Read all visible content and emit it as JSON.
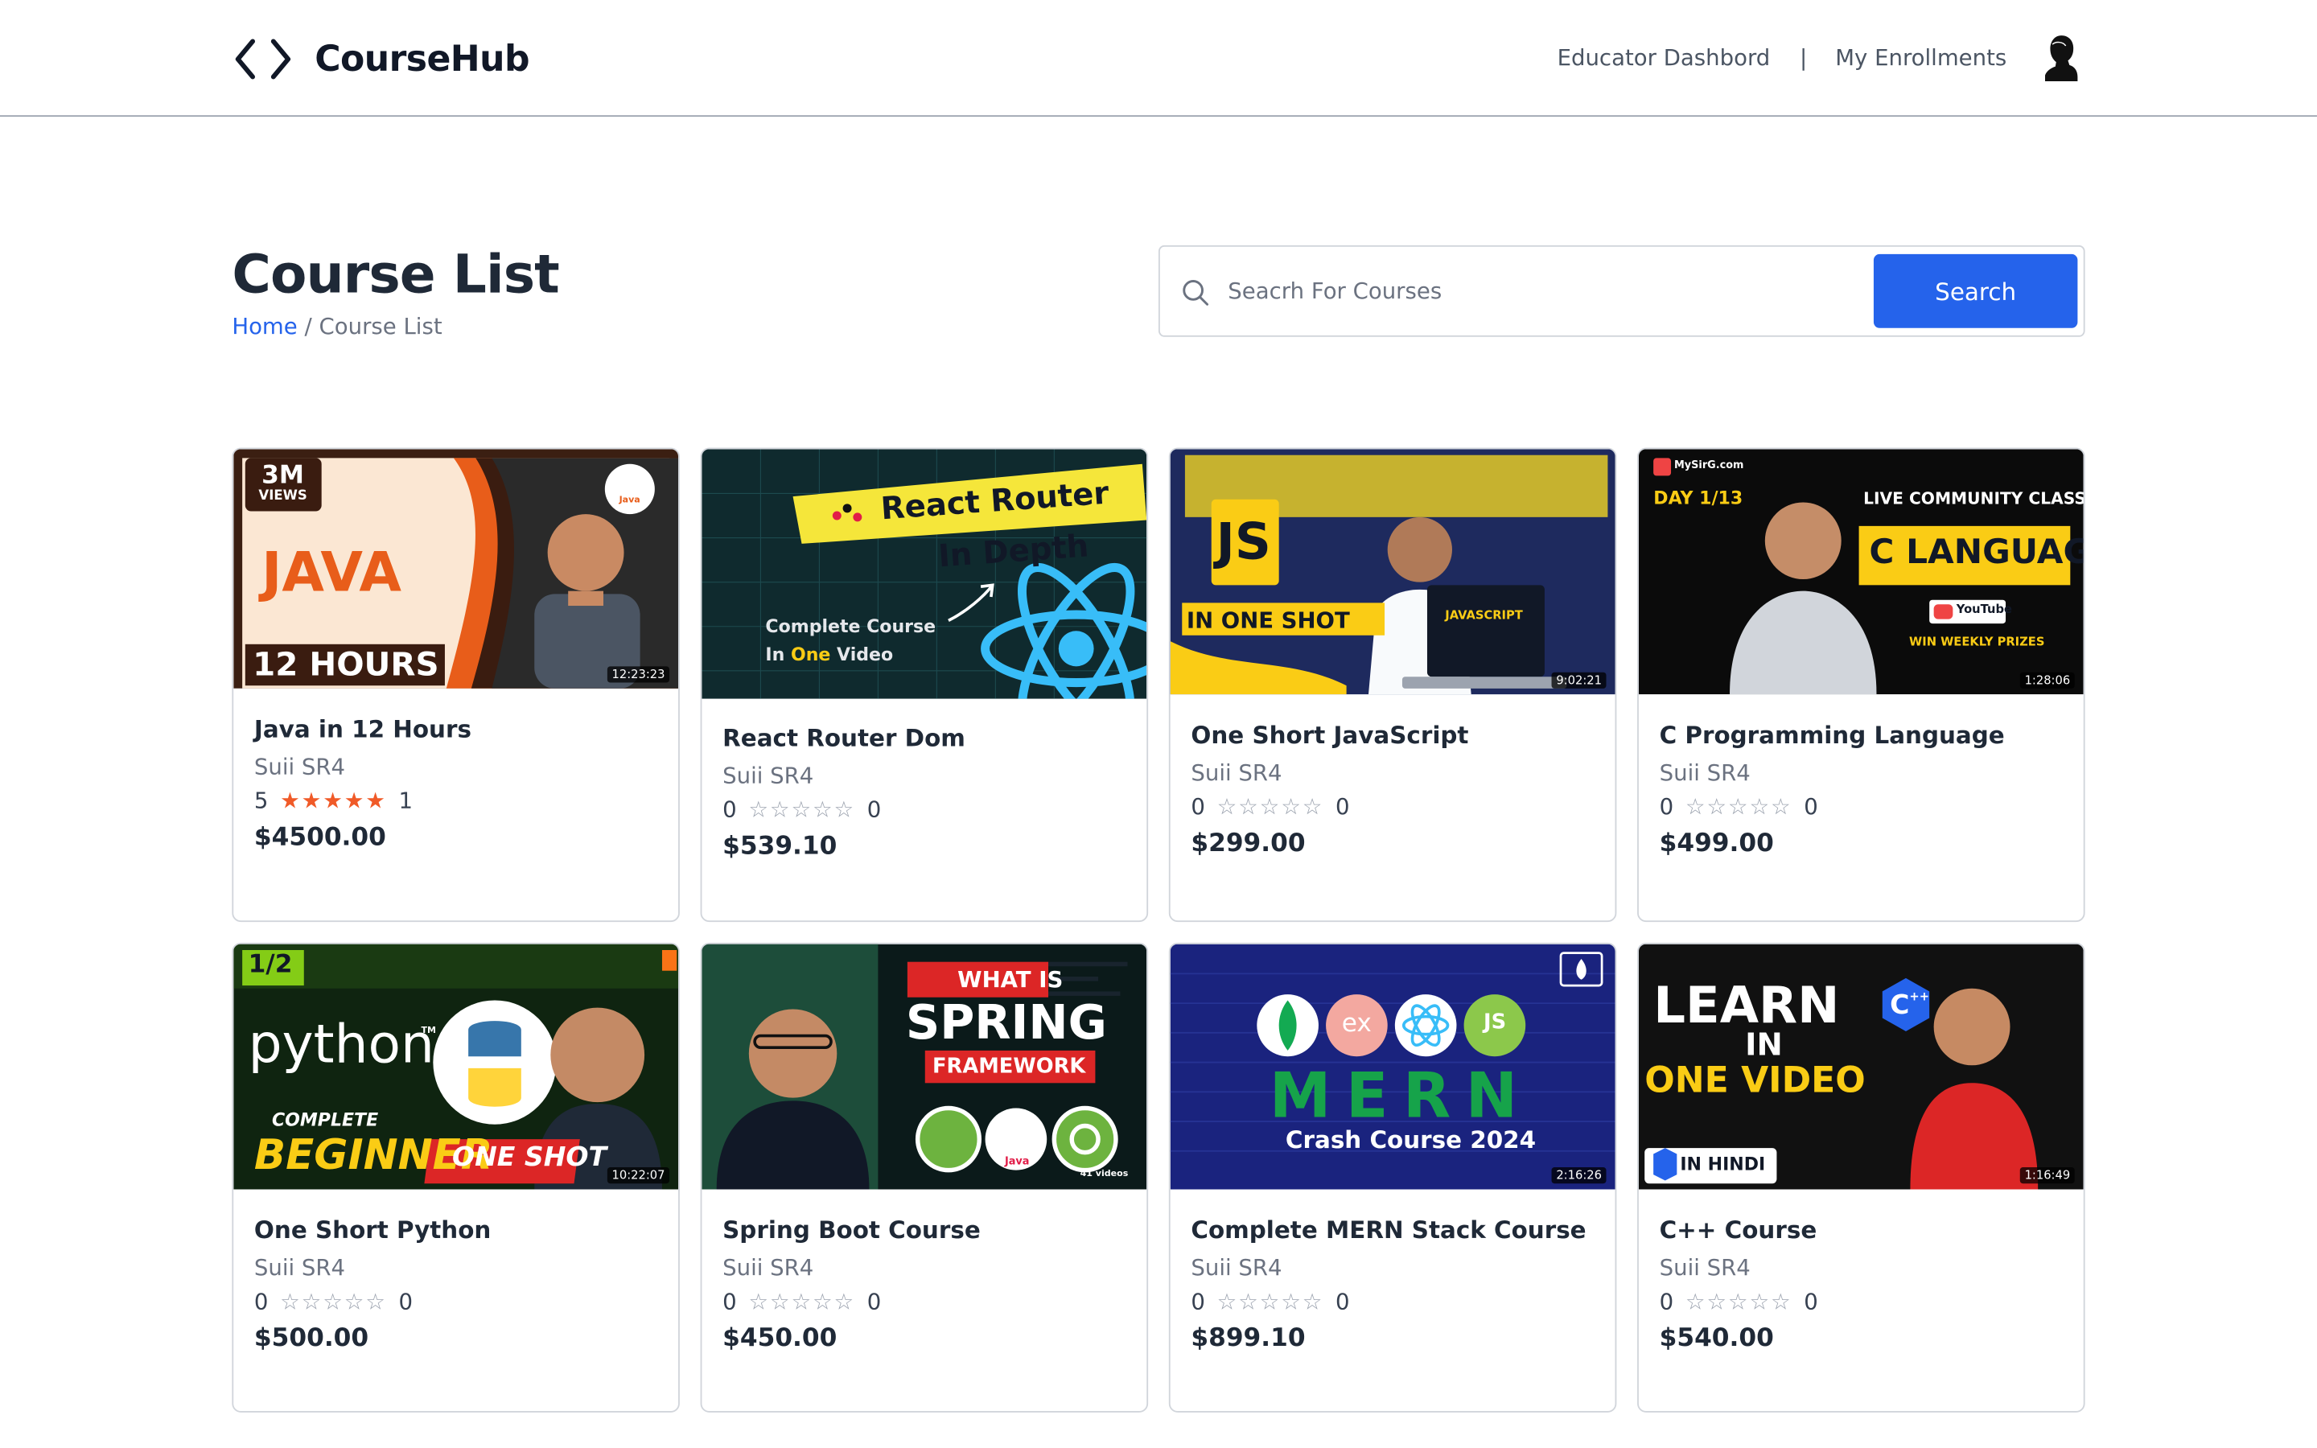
{
  "header": {
    "brand": "CourseHub",
    "nav": {
      "educator": "Educator Dashbord",
      "separator": "|",
      "enrollments": "My Enrollments"
    }
  },
  "page": {
    "title": "Course List",
    "breadcrumb_home": "Home",
    "breadcrumb_rest": " / Course List"
  },
  "search": {
    "placeholder": "Seacrh For Courses",
    "button": "Search"
  },
  "courses": [
    {
      "title": "Java in 12 Hours",
      "instructor": "Suii SR4",
      "rating": "5",
      "stars": "★★★★★",
      "reviews": "1",
      "price": "$4500.00",
      "thumb": {
        "badge": "3M",
        "badge2": "VIEWS",
        "main": "JAVA",
        "sub": "12 HOURS",
        "logo": "Java",
        "duration": "12:23:23"
      }
    },
    {
      "title": "React Router Dom",
      "instructor": "Suii SR4",
      "rating": "0",
      "stars": "☆☆☆☆☆",
      "reviews": "0",
      "price": "$539.10",
      "thumb": {
        "main": "React Router",
        "sub": "In Depth",
        "line1": "Complete Course",
        "line2a": "In ",
        "line2b": "One",
        "line2c": " Video"
      }
    },
    {
      "title": "One Short JavaScript",
      "instructor": "Suii SR4",
      "rating": "0",
      "stars": "☆☆☆☆☆",
      "reviews": "0",
      "price": "$299.00",
      "thumb": {
        "logo": "JS",
        "main": "IN ONE SHOT",
        "screen": "JAVASCRIPT",
        "duration": "9:02:21"
      }
    },
    {
      "title": "C Programming Language",
      "instructor": "Suii SR4",
      "rating": "0",
      "stars": "☆☆☆☆☆",
      "reviews": "0",
      "price": "$499.00",
      "thumb": {
        "site": "MySirG.com",
        "day": "DAY 1/13",
        "top": "LIVE COMMUNITY CLASSES",
        "main": "C LANGUAGE",
        "yt": "YouTube",
        "prize": "WIN WEEKLY PRIZES",
        "duration": "1:28:06"
      }
    },
    {
      "title": "One Short Python",
      "instructor": "Suii SR4",
      "rating": "0",
      "stars": "☆☆☆☆☆",
      "reviews": "0",
      "price": "$500.00",
      "thumb": {
        "badge": "1/2",
        "main": "python",
        "tm": "TM",
        "complete": "COMPLETE",
        "beginner": "BEGINNER",
        "oneshot": "ONE SHOT",
        "duration": "10:22:07"
      }
    },
    {
      "title": "Spring Boot Course",
      "instructor": "Suii SR4",
      "rating": "0",
      "stars": "☆☆☆☆☆",
      "reviews": "0",
      "price": "$450.00",
      "thumb": {
        "top": "WHAT IS",
        "main": "SPRING",
        "sub": "FRAMEWORK",
        "java": "Java",
        "videos": "41 videos"
      }
    },
    {
      "title": "Complete MERN Stack Course",
      "instructor": "Suii SR4",
      "rating": "0",
      "stars": "☆☆☆☆☆",
      "reviews": "0",
      "price": "$899.10",
      "thumb": {
        "ex": "ex",
        "js": "JS",
        "main": "MERN",
        "sub": "Crash Course 2024",
        "duration": "2:16:26"
      }
    },
    {
      "title": "C++ Course",
      "instructor": "Suii SR4",
      "rating": "0",
      "stars": "☆☆☆☆☆",
      "reviews": "0",
      "price": "$540.00",
      "thumb": {
        "main": "LEARN",
        "in": "IN",
        "sub": "ONE VIDEO",
        "cpp": "C",
        "pp": "++",
        "hindi": "IN HINDI",
        "duration": "1:16:49"
      }
    }
  ]
}
